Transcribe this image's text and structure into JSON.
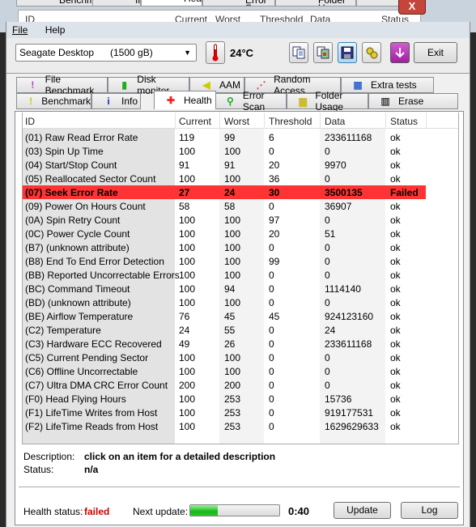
{
  "background_window": {
    "tabs": [
      "Benchmark",
      "Info",
      "Health",
      "Error Scan",
      "Folder Usage",
      "Erase"
    ],
    "columns": [
      "ID",
      "Current",
      "Worst",
      "Threshold",
      "Data",
      "Status"
    ],
    "close_glyph": "X"
  },
  "menu": {
    "file": "File",
    "help": "Help"
  },
  "toolbar": {
    "drive_name": "Seagate Desktop",
    "drive_capacity": "(1500 gB)",
    "temperature": "24°C",
    "exit_label": "Exit",
    "icons": [
      "copy-text-icon",
      "copy-screenshot-icon",
      "save-icon",
      "options-icon",
      "download-icon"
    ]
  },
  "tabs_row1": [
    {
      "label": "File Benchmark",
      "icon": "file-benchmark-icon"
    },
    {
      "label": "Disk monitor",
      "icon": "disk-monitor-icon"
    },
    {
      "label": "AAM",
      "icon": "speaker-icon"
    },
    {
      "label": "Random Access",
      "icon": "random-access-icon"
    },
    {
      "label": "Extra tests",
      "icon": "extra-tests-icon"
    }
  ],
  "tabs_row2": [
    {
      "label": "Benchmark",
      "icon": "exclamation-icon"
    },
    {
      "label": "Info",
      "icon": "info-icon"
    },
    {
      "label": "Health",
      "icon": "red-cross-icon",
      "selected": true
    },
    {
      "label": "Error Scan",
      "icon": "magnifier-icon"
    },
    {
      "label": "Folder Usage",
      "icon": "folder-icon"
    },
    {
      "label": "Erase",
      "icon": "trash-icon"
    }
  ],
  "table": {
    "columns": [
      "ID",
      "Current",
      "Worst",
      "Threshold",
      "Data",
      "Status"
    ],
    "rows": [
      [
        "(01) Raw Read Error Rate",
        "119",
        "99",
        "6",
        "233611168",
        "ok"
      ],
      [
        "(03) Spin Up Time",
        "100",
        "100",
        "0",
        "0",
        "ok"
      ],
      [
        "(04) Start/Stop Count",
        "91",
        "91",
        "20",
        "9970",
        "ok"
      ],
      [
        "(05) Reallocated Sector Count",
        "100",
        "100",
        "36",
        "0",
        "ok"
      ],
      [
        "(07) Seek Error Rate",
        "27",
        "24",
        "30",
        "3500135",
        "Failed"
      ],
      [
        "(09) Power On Hours Count",
        "58",
        "58",
        "0",
        "36907",
        "ok"
      ],
      [
        "(0A) Spin Retry Count",
        "100",
        "100",
        "97",
        "0",
        "ok"
      ],
      [
        "(0C) Power Cycle Count",
        "100",
        "100",
        "20",
        "51",
        "ok"
      ],
      [
        "(B7) (unknown attribute)",
        "100",
        "100",
        "0",
        "0",
        "ok"
      ],
      [
        "(B8) End To End Error Detection",
        "100",
        "100",
        "99",
        "0",
        "ok"
      ],
      [
        "(BB) Reported Uncorrectable Errors",
        "100",
        "100",
        "0",
        "0",
        "ok"
      ],
      [
        "(BC) Command Timeout",
        "100",
        "94",
        "0",
        "1114140",
        "ok"
      ],
      [
        "(BD) (unknown attribute)",
        "100",
        "100",
        "0",
        "0",
        "ok"
      ],
      [
        "(BE) Airflow Temperature",
        "76",
        "45",
        "45",
        "924123160",
        "ok"
      ],
      [
        "(C2) Temperature",
        "24",
        "55",
        "0",
        "24",
        "ok"
      ],
      [
        "(C3) Hardware ECC Recovered",
        "49",
        "26",
        "0",
        "233611168",
        "ok"
      ],
      [
        "(C5) Current Pending Sector",
        "100",
        "100",
        "0",
        "0",
        "ok"
      ],
      [
        "(C6) Offline Uncorrectable",
        "100",
        "100",
        "0",
        "0",
        "ok"
      ],
      [
        "(C7) Ultra DMA CRC Error Count",
        "200",
        "200",
        "0",
        "0",
        "ok"
      ],
      [
        "(F0) Head Flying Hours",
        "100",
        "253",
        "0",
        "15736",
        "ok"
      ],
      [
        "(F1) LifeTime Writes from Host",
        "100",
        "253",
        "0",
        "919177531",
        "ok"
      ],
      [
        "(F2) LifeTime Reads from Host",
        "100",
        "253",
        "0",
        "1629629633",
        "ok"
      ]
    ],
    "failed_row_color": "#ff3333"
  },
  "details": {
    "description_label": "Description:",
    "description_value": "click on an item for a detailed description",
    "status_label": "Status:",
    "status_value": "n/a"
  },
  "footer": {
    "health_label": "Health status:",
    "health_value": "failed",
    "health_color": "#cc0000",
    "next_update_label": "Next update:",
    "next_update_progress_percent": 31,
    "countdown": "0:40",
    "update_label": "Update",
    "log_label": "Log"
  }
}
